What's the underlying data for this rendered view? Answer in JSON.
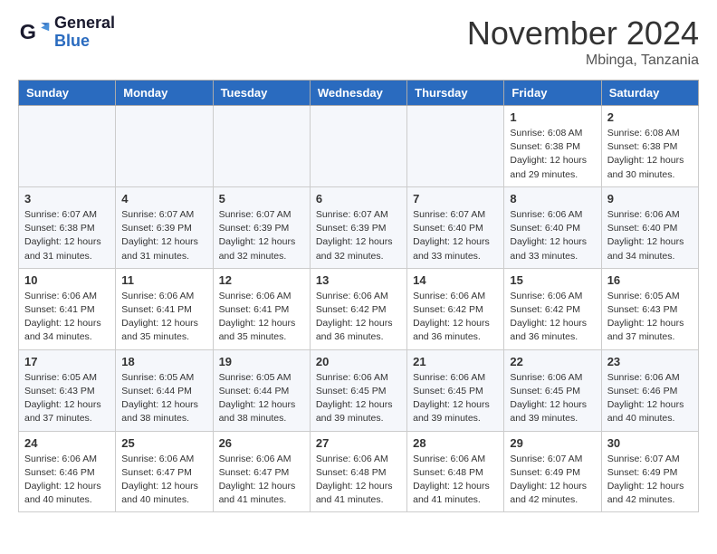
{
  "header": {
    "logo_general": "General",
    "logo_blue": "Blue",
    "month_title": "November 2024",
    "location": "Mbinga, Tanzania"
  },
  "days_of_week": [
    "Sunday",
    "Monday",
    "Tuesday",
    "Wednesday",
    "Thursday",
    "Friday",
    "Saturday"
  ],
  "weeks": [
    [
      {
        "day": "",
        "info": ""
      },
      {
        "day": "",
        "info": ""
      },
      {
        "day": "",
        "info": ""
      },
      {
        "day": "",
        "info": ""
      },
      {
        "day": "",
        "info": ""
      },
      {
        "day": "1",
        "info": "Sunrise: 6:08 AM\nSunset: 6:38 PM\nDaylight: 12 hours\nand 29 minutes."
      },
      {
        "day": "2",
        "info": "Sunrise: 6:08 AM\nSunset: 6:38 PM\nDaylight: 12 hours\nand 30 minutes."
      }
    ],
    [
      {
        "day": "3",
        "info": "Sunrise: 6:07 AM\nSunset: 6:38 PM\nDaylight: 12 hours\nand 31 minutes."
      },
      {
        "day": "4",
        "info": "Sunrise: 6:07 AM\nSunset: 6:39 PM\nDaylight: 12 hours\nand 31 minutes."
      },
      {
        "day": "5",
        "info": "Sunrise: 6:07 AM\nSunset: 6:39 PM\nDaylight: 12 hours\nand 32 minutes."
      },
      {
        "day": "6",
        "info": "Sunrise: 6:07 AM\nSunset: 6:39 PM\nDaylight: 12 hours\nand 32 minutes."
      },
      {
        "day": "7",
        "info": "Sunrise: 6:07 AM\nSunset: 6:40 PM\nDaylight: 12 hours\nand 33 minutes."
      },
      {
        "day": "8",
        "info": "Sunrise: 6:06 AM\nSunset: 6:40 PM\nDaylight: 12 hours\nand 33 minutes."
      },
      {
        "day": "9",
        "info": "Sunrise: 6:06 AM\nSunset: 6:40 PM\nDaylight: 12 hours\nand 34 minutes."
      }
    ],
    [
      {
        "day": "10",
        "info": "Sunrise: 6:06 AM\nSunset: 6:41 PM\nDaylight: 12 hours\nand 34 minutes."
      },
      {
        "day": "11",
        "info": "Sunrise: 6:06 AM\nSunset: 6:41 PM\nDaylight: 12 hours\nand 35 minutes."
      },
      {
        "day": "12",
        "info": "Sunrise: 6:06 AM\nSunset: 6:41 PM\nDaylight: 12 hours\nand 35 minutes."
      },
      {
        "day": "13",
        "info": "Sunrise: 6:06 AM\nSunset: 6:42 PM\nDaylight: 12 hours\nand 36 minutes."
      },
      {
        "day": "14",
        "info": "Sunrise: 6:06 AM\nSunset: 6:42 PM\nDaylight: 12 hours\nand 36 minutes."
      },
      {
        "day": "15",
        "info": "Sunrise: 6:06 AM\nSunset: 6:42 PM\nDaylight: 12 hours\nand 36 minutes."
      },
      {
        "day": "16",
        "info": "Sunrise: 6:05 AM\nSunset: 6:43 PM\nDaylight: 12 hours\nand 37 minutes."
      }
    ],
    [
      {
        "day": "17",
        "info": "Sunrise: 6:05 AM\nSunset: 6:43 PM\nDaylight: 12 hours\nand 37 minutes."
      },
      {
        "day": "18",
        "info": "Sunrise: 6:05 AM\nSunset: 6:44 PM\nDaylight: 12 hours\nand 38 minutes."
      },
      {
        "day": "19",
        "info": "Sunrise: 6:05 AM\nSunset: 6:44 PM\nDaylight: 12 hours\nand 38 minutes."
      },
      {
        "day": "20",
        "info": "Sunrise: 6:06 AM\nSunset: 6:45 PM\nDaylight: 12 hours\nand 39 minutes."
      },
      {
        "day": "21",
        "info": "Sunrise: 6:06 AM\nSunset: 6:45 PM\nDaylight: 12 hours\nand 39 minutes."
      },
      {
        "day": "22",
        "info": "Sunrise: 6:06 AM\nSunset: 6:45 PM\nDaylight: 12 hours\nand 39 minutes."
      },
      {
        "day": "23",
        "info": "Sunrise: 6:06 AM\nSunset: 6:46 PM\nDaylight: 12 hours\nand 40 minutes."
      }
    ],
    [
      {
        "day": "24",
        "info": "Sunrise: 6:06 AM\nSunset: 6:46 PM\nDaylight: 12 hours\nand 40 minutes."
      },
      {
        "day": "25",
        "info": "Sunrise: 6:06 AM\nSunset: 6:47 PM\nDaylight: 12 hours\nand 40 minutes."
      },
      {
        "day": "26",
        "info": "Sunrise: 6:06 AM\nSunset: 6:47 PM\nDaylight: 12 hours\nand 41 minutes."
      },
      {
        "day": "27",
        "info": "Sunrise: 6:06 AM\nSunset: 6:48 PM\nDaylight: 12 hours\nand 41 minutes."
      },
      {
        "day": "28",
        "info": "Sunrise: 6:06 AM\nSunset: 6:48 PM\nDaylight: 12 hours\nand 41 minutes."
      },
      {
        "day": "29",
        "info": "Sunrise: 6:07 AM\nSunset: 6:49 PM\nDaylight: 12 hours\nand 42 minutes."
      },
      {
        "day": "30",
        "info": "Sunrise: 6:07 AM\nSunset: 6:49 PM\nDaylight: 12 hours\nand 42 minutes."
      }
    ]
  ]
}
